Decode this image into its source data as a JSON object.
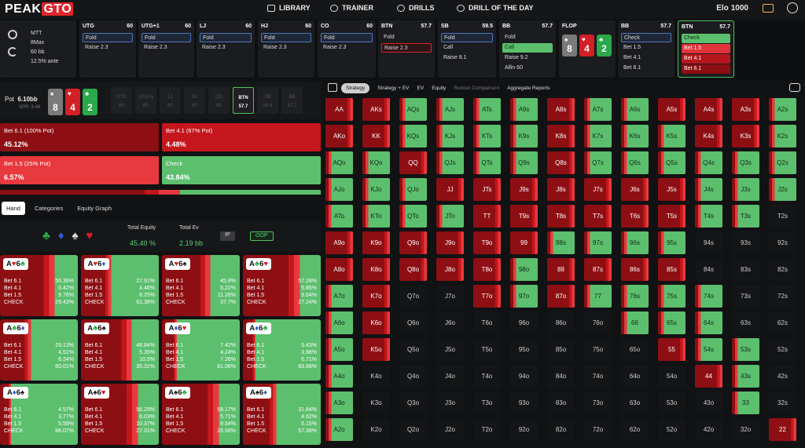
{
  "logo": {
    "text": "PEAK",
    "accent": "GTO"
  },
  "nav": [
    {
      "label": "LIBRARY"
    },
    {
      "label": "TRAINER"
    },
    {
      "label": "DRILLS"
    },
    {
      "label": "DRILL OF THE DAY"
    }
  ],
  "elo": {
    "label": "Elo",
    "value": "1000"
  },
  "game_info": {
    "lines": [
      "MTT",
      "8Max",
      "60 bb",
      "12.5% ante"
    ]
  },
  "seats": [
    {
      "name": "UTG",
      "stack": "60",
      "actions": [
        {
          "label": "Fold",
          "style": "sel-blue"
        },
        {
          "label": "Raise 2.3",
          "style": ""
        }
      ]
    },
    {
      "name": "UTG+1",
      "stack": "60",
      "actions": [
        {
          "label": "Fold",
          "style": "sel-blue"
        },
        {
          "label": "Raise 2.3",
          "style": ""
        }
      ]
    },
    {
      "name": "LJ",
      "stack": "60",
      "actions": [
        {
          "label": "Fold",
          "style": "sel-blue"
        },
        {
          "label": "Raise 2.3",
          "style": ""
        }
      ]
    },
    {
      "name": "HJ",
      "stack": "60",
      "actions": [
        {
          "label": "Fold",
          "style": "sel-blue"
        },
        {
          "label": "Raise 2.3",
          "style": ""
        }
      ]
    },
    {
      "name": "CO",
      "stack": "60",
      "actions": [
        {
          "label": "Fold",
          "style": "sel-blue"
        },
        {
          "label": "Raise 2.3",
          "style": ""
        }
      ]
    },
    {
      "name": "BTN",
      "stack": "57.7",
      "actions": [
        {
          "label": "Fold",
          "style": ""
        },
        {
          "label": "Raise 2.3",
          "style": "sel-red"
        }
      ]
    },
    {
      "name": "SB",
      "stack": "59.5",
      "actions": [
        {
          "label": "Fold",
          "style": "sel-blue"
        },
        {
          "label": "Call",
          "style": ""
        },
        {
          "label": "Raise 8.1",
          "style": ""
        }
      ]
    },
    {
      "name": "BB",
      "stack": "57.7",
      "actions": [
        {
          "label": "Fold",
          "style": ""
        },
        {
          "label": "Call",
          "style": "green"
        },
        {
          "label": "Raise 9.2",
          "style": ""
        },
        {
          "label": "Allin 60",
          "style": ""
        }
      ]
    },
    {
      "name": "FLOP",
      "stack": "",
      "actions": []
    },
    {
      "name": "BB",
      "stack": "57.7",
      "actions": [
        {
          "label": "Check",
          "style": "sel-blue"
        },
        {
          "label": "Bet 1.5",
          "style": ""
        },
        {
          "label": "Bet 4.1",
          "style": ""
        },
        {
          "label": "Bet 6.1",
          "style": ""
        }
      ]
    },
    {
      "name": "BTN",
      "stack": "57.7",
      "actions": [
        {
          "label": "Check",
          "style": "green"
        },
        {
          "label": "Bet 1.5",
          "style": "red1"
        },
        {
          "label": "Bet 4.1",
          "style": "red2"
        },
        {
          "label": "Bet 6.1",
          "style": "red3"
        }
      ]
    }
  ],
  "flop_cards": [
    {
      "rank": "8",
      "suit": "♠",
      "color": "gray"
    },
    {
      "rank": "4",
      "suit": "♥",
      "color": "red"
    },
    {
      "rank": "2",
      "suit": "♣",
      "color": "green"
    }
  ],
  "pot": {
    "label": "Pot",
    "value": "6.10bb",
    "spr": "SPR: 9.46"
  },
  "positions": [
    {
      "name": "UTG",
      "stack": "60"
    },
    {
      "name": "UTG+1",
      "stack": "60"
    },
    {
      "name": "LJ",
      "stack": "60"
    },
    {
      "name": "HJ",
      "stack": "60"
    },
    {
      "name": "CO",
      "stack": "60"
    },
    {
      "name": "BTN",
      "stack": "57.7",
      "active": true
    },
    {
      "name": "SB",
      "stack": "59.5"
    },
    {
      "name": "BB",
      "stack": "57.7"
    }
  ],
  "strategy_actions": [
    {
      "label": "Bet 6.1 (100% Pot)",
      "value": "45.12%",
      "color": "#8e0f13"
    },
    {
      "label": "Bet 4.1 (67% Pot)",
      "value": "4.48%",
      "color": "#c4161c"
    },
    {
      "label": "Bet 1.5 (25% Pot)",
      "value": "6.57%",
      "color": "#e8393e"
    },
    {
      "label": "Check",
      "value": "43.84%",
      "color": "#5cbf6e"
    }
  ],
  "panel_tabs": [
    {
      "label": "Hand",
      "active": true
    },
    {
      "label": "Categories"
    },
    {
      "label": "Equity Graph"
    }
  ],
  "equity": {
    "total_equity_label": "Total Equity",
    "total_equity": "45.40 %",
    "total_ev_label": "Total Ev",
    "total_ev": "2.19 bb",
    "ip": "IP",
    "oop": "OOP"
  },
  "suit_filters": [
    {
      "s": "♣",
      "c": "#2aa84a"
    },
    {
      "s": "♦",
      "c": "#2e5bd6"
    },
    {
      "s": "♠",
      "c": "#dddddd"
    },
    {
      "s": "♥",
      "c": "#d31f26"
    }
  ],
  "hands": [
    {
      "c1": "A♥",
      "c2": "6♣",
      "rows": [
        [
          "Bet 6.1",
          "55.36%"
        ],
        [
          "Bet 4.1",
          "5.42%"
        ],
        [
          "Bet 1.5",
          "9.76%"
        ],
        [
          "CHECK",
          "29.43%"
        ]
      ],
      "fill": 0.7
    },
    {
      "c1": "A♥",
      "c2": "6♦",
      "rows": [
        [
          "Bet 6.1",
          "27.91%"
        ],
        [
          "Bet 4.1",
          "4.46%"
        ],
        [
          "Bet 1.5",
          "6.25%"
        ],
        [
          "CHECK",
          "61.38%"
        ]
      ],
      "fill": 0.39
    },
    {
      "c1": "A♥",
      "c2": "6♠",
      "rows": [
        [
          "Bet 6.1",
          "45.8%"
        ],
        [
          "Bet 4.1",
          "5.22%"
        ],
        [
          "Bet 1.5",
          "11.26%"
        ],
        [
          "CHECK",
          "37.7%"
        ]
      ],
      "fill": 0.62
    },
    {
      "c1": "A♣",
      "c2": "6♥",
      "rows": [
        [
          "Bet 6.1",
          "57.28%"
        ],
        [
          "Bet 4.1",
          "5.85%"
        ],
        [
          "Bet 1.5",
          "9.64%"
        ],
        [
          "CHECK",
          "27.24%"
        ]
      ],
      "fill": 0.73
    },
    {
      "c1": "A♣",
      "c2": "6♦",
      "rows": [
        [
          "Bet 6.1",
          "29.13%"
        ],
        [
          "Bet 4.1",
          "4.51%"
        ],
        [
          "Bet 1.5",
          "6.34%"
        ],
        [
          "CHECK",
          "60.01%"
        ]
      ],
      "fill": 0.4
    },
    {
      "c1": "A♣",
      "c2": "6♠",
      "rows": [
        [
          "Bet 6.1",
          "48.84%"
        ],
        [
          "Bet 4.1",
          "5.35%"
        ],
        [
          "Bet 1.5",
          "10.5%"
        ],
        [
          "CHECK",
          "35.31%"
        ]
      ],
      "fill": 0.65
    },
    {
      "c1": "A♦",
      "c2": "6♥",
      "rows": [
        [
          "Bet 6.1",
          "7.42%"
        ],
        [
          "Bet 4.1",
          "4.24%"
        ],
        [
          "Bet 1.5",
          "7.26%"
        ],
        [
          "CHECK",
          "81.06%"
        ]
      ],
      "fill": 0.19
    },
    {
      "c1": "A♦",
      "c2": "6♣",
      "rows": [
        [
          "Bet 6.1",
          "5.43%"
        ],
        [
          "Bet 4.1",
          "3.98%"
        ],
        [
          "Bet 1.5",
          "6.71%"
        ],
        [
          "CHECK",
          "83.88%"
        ]
      ],
      "fill": 0.16
    },
    {
      "c1": "A♦",
      "c2": "6♠",
      "rows": [
        [
          "Bet 6.1",
          "4.57%"
        ],
        [
          "Bet 4.1",
          "3.77%"
        ],
        [
          "Bet 1.5",
          "5.59%"
        ],
        [
          "CHECK",
          "86.07%"
        ]
      ],
      "fill": 0.14
    },
    {
      "c1": "A♠",
      "c2": "6♥",
      "rows": [
        [
          "Bet 6.1",
          "56.29%"
        ],
        [
          "Bet 4.1",
          "6.03%"
        ],
        [
          "Bet 1.5",
          "10.37%"
        ],
        [
          "CHECK",
          "27.31%"
        ]
      ],
      "fill": 0.73
    },
    {
      "c1": "A♠",
      "c2": "6♣",
      "rows": [
        [
          "Bet 6.1",
          "58.17%"
        ],
        [
          "Bet 4.1",
          "5.71%"
        ],
        [
          "Bet 1.5",
          "9.54%"
        ],
        [
          "CHECK",
          "26.56%"
        ]
      ],
      "fill": 0.73
    },
    {
      "c1": "A♠",
      "c2": "6♦",
      "rows": [
        [
          "Bet 6.1",
          "31.84%"
        ],
        [
          "Bet 4.1",
          "4.62%"
        ],
        [
          "Bet 1.5",
          "6.15%"
        ],
        [
          "CHECK",
          "57.38%"
        ]
      ],
      "fill": 0.43
    }
  ],
  "grid_tabs": [
    {
      "label": "Strategy",
      "active": true
    },
    {
      "label": "Strategy + EV"
    },
    {
      "label": "EV"
    },
    {
      "label": "Equity"
    },
    {
      "label": "Runout Comparison",
      "dim": true
    },
    {
      "label": "Aggregate Reports"
    }
  ],
  "grid": [
    [
      "AA",
      "AKs",
      "AQs",
      "AJs",
      "ATs",
      "A9s",
      "A8s",
      "A7s",
      "A6s",
      "A5s",
      "A4s",
      "A3s",
      "A2s"
    ],
    [
      "AKo",
      "KK",
      "KQs",
      "KJs",
      "KTs",
      "K9s",
      "K8s",
      "K7s",
      "K6s",
      "K5s",
      "K4s",
      "K3s",
      "K2s"
    ],
    [
      "AQo",
      "KQo",
      "QQ",
      "QJs",
      "QTs",
      "Q9s",
      "Q8s",
      "Q7s",
      "Q6s",
      "Q5s",
      "Q4s",
      "Q3s",
      "Q2s"
    ],
    [
      "AJo",
      "KJo",
      "QJo",
      "JJ",
      "JTs",
      "J9s",
      "J8s",
      "J7s",
      "J6s",
      "J5s",
      "J4s",
      "J3s",
      "J2s"
    ],
    [
      "ATo",
      "KTo",
      "QTo",
      "JTo",
      "TT",
      "T9s",
      "T8s",
      "T7s",
      "T6s",
      "T5s",
      "T4s",
      "T3s",
      "T2s"
    ],
    [
      "A9o",
      "K9o",
      "Q9o",
      "J9o",
      "T9o",
      "99",
      "98s",
      "97s",
      "96s",
      "95s",
      "94s",
      "93s",
      "92s"
    ],
    [
      "A8o",
      "K8o",
      "Q8o",
      "J8o",
      "T8o",
      "98o",
      "88",
      "87s",
      "86s",
      "85s",
      "84s",
      "83s",
      "82s"
    ],
    [
      "A7o",
      "K7o",
      "Q7o",
      "J7o",
      "T7o",
      "97o",
      "87o",
      "77",
      "76s",
      "75s",
      "74s",
      "73s",
      "72s"
    ],
    [
      "A6o",
      "K6o",
      "Q6o",
      "J6o",
      "T6o",
      "96o",
      "86o",
      "76o",
      "66",
      "65s",
      "64s",
      "63s",
      "62s"
    ],
    [
      "A5o",
      "K5o",
      "Q5o",
      "J5o",
      "T5o",
      "95o",
      "85o",
      "75o",
      "65o",
      "55",
      "54s",
      "53s",
      "52s"
    ],
    [
      "A4o",
      "K4o",
      "Q4o",
      "J4o",
      "T4o",
      "94o",
      "84o",
      "74o",
      "64o",
      "54o",
      "44",
      "43s",
      "42s"
    ],
    [
      "A3o",
      "K3o",
      "Q3o",
      "J3o",
      "T3o",
      "93o",
      "83o",
      "73o",
      "63o",
      "53o",
      "43o",
      "33",
      "32s"
    ],
    [
      "A2o",
      "K2o",
      "Q2o",
      "J2o",
      "T2o",
      "92o",
      "82o",
      "72o",
      "62o",
      "52o",
      "42o",
      "32o",
      "22"
    ]
  ],
  "grid_mix": [
    [
      "R",
      "R",
      "G",
      "G",
      "G",
      "G",
      "R",
      "G",
      "G",
      "R",
      "R",
      "R",
      "G"
    ],
    [
      "R",
      "R",
      "G",
      "G",
      "G",
      "G",
      "R",
      "G",
      "G",
      "G",
      "R",
      "R",
      "G"
    ],
    [
      "G",
      "G",
      "R",
      "G",
      "G",
      "G",
      "R",
      "G",
      "G",
      "G",
      "G",
      "G",
      "G"
    ],
    [
      "G",
      "G",
      "G",
      "R",
      "R",
      "R",
      "R",
      "R",
      "R",
      "R",
      "G",
      "G",
      "G"
    ],
    [
      "G",
      "G",
      "G",
      "G",
      "R",
      "R",
      "R",
      "R",
      "R",
      "R",
      "G",
      "G",
      "N"
    ],
    [
      "R",
      "R",
      "R",
      "R",
      "R",
      "R",
      "G",
      "G",
      "G",
      "G",
      "N",
      "N",
      "N"
    ],
    [
      "R",
      "R",
      "R",
      "R",
      "R",
      "G",
      "R",
      "R",
      "R",
      "R",
      "N",
      "N",
      "N"
    ],
    [
      "G",
      "R",
      "N",
      "N",
      "R",
      "G",
      "R",
      "G",
      "G",
      "G",
      "G",
      "N",
      "N"
    ],
    [
      "G",
      "R",
      "N",
      "N",
      "N",
      "N",
      "N",
      "N",
      "G",
      "G",
      "G",
      "N",
      "N"
    ],
    [
      "G",
      "R",
      "N",
      "N",
      "N",
      "N",
      "N",
      "N",
      "N",
      "R",
      "G",
      "G",
      "N"
    ],
    [
      "G",
      "N",
      "N",
      "N",
      "N",
      "N",
      "N",
      "N",
      "N",
      "N",
      "R",
      "G",
      "N"
    ],
    [
      "G",
      "N",
      "N",
      "N",
      "N",
      "N",
      "N",
      "N",
      "N",
      "N",
      "N",
      "G",
      "N"
    ],
    [
      "G",
      "N",
      "N",
      "N",
      "N",
      "N",
      "N",
      "N",
      "N",
      "N",
      "N",
      "N",
      "R"
    ]
  ],
  "colors": {
    "green": "#5cbf6e",
    "dark_red": "#8e0f13",
    "red": "#c4161c",
    "light_red": "#e8393e",
    "empty": "#141517",
    "active": "#4ec364"
  }
}
